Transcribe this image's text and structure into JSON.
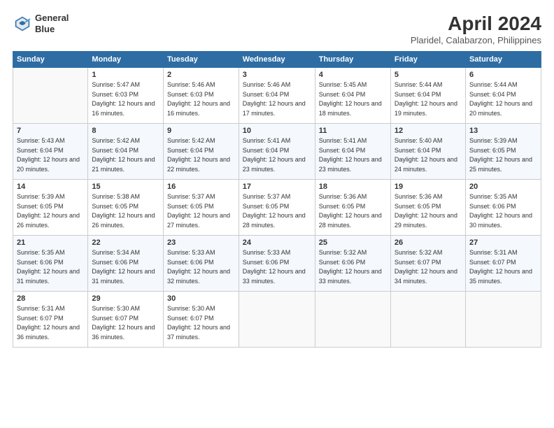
{
  "header": {
    "logo_line1": "General",
    "logo_line2": "Blue",
    "month": "April 2024",
    "location": "Plaridel, Calabarzon, Philippines"
  },
  "weekdays": [
    "Sunday",
    "Monday",
    "Tuesday",
    "Wednesday",
    "Thursday",
    "Friday",
    "Saturday"
  ],
  "weeks": [
    [
      {
        "day": "",
        "sunrise": "",
        "sunset": "",
        "daylight": "",
        "empty": true
      },
      {
        "day": "1",
        "sunrise": "Sunrise: 5:47 AM",
        "sunset": "Sunset: 6:03 PM",
        "daylight": "Daylight: 12 hours and 16 minutes."
      },
      {
        "day": "2",
        "sunrise": "Sunrise: 5:46 AM",
        "sunset": "Sunset: 6:03 PM",
        "daylight": "Daylight: 12 hours and 16 minutes."
      },
      {
        "day": "3",
        "sunrise": "Sunrise: 5:46 AM",
        "sunset": "Sunset: 6:04 PM",
        "daylight": "Daylight: 12 hours and 17 minutes."
      },
      {
        "day": "4",
        "sunrise": "Sunrise: 5:45 AM",
        "sunset": "Sunset: 6:04 PM",
        "daylight": "Daylight: 12 hours and 18 minutes."
      },
      {
        "day": "5",
        "sunrise": "Sunrise: 5:44 AM",
        "sunset": "Sunset: 6:04 PM",
        "daylight": "Daylight: 12 hours and 19 minutes."
      },
      {
        "day": "6",
        "sunrise": "Sunrise: 5:44 AM",
        "sunset": "Sunset: 6:04 PM",
        "daylight": "Daylight: 12 hours and 20 minutes."
      }
    ],
    [
      {
        "day": "7",
        "sunrise": "Sunrise: 5:43 AM",
        "sunset": "Sunset: 6:04 PM",
        "daylight": "Daylight: 12 hours and 20 minutes."
      },
      {
        "day": "8",
        "sunrise": "Sunrise: 5:42 AM",
        "sunset": "Sunset: 6:04 PM",
        "daylight": "Daylight: 12 hours and 21 minutes."
      },
      {
        "day": "9",
        "sunrise": "Sunrise: 5:42 AM",
        "sunset": "Sunset: 6:04 PM",
        "daylight": "Daylight: 12 hours and 22 minutes."
      },
      {
        "day": "10",
        "sunrise": "Sunrise: 5:41 AM",
        "sunset": "Sunset: 6:04 PM",
        "daylight": "Daylight: 12 hours and 23 minutes."
      },
      {
        "day": "11",
        "sunrise": "Sunrise: 5:41 AM",
        "sunset": "Sunset: 6:04 PM",
        "daylight": "Daylight: 12 hours and 23 minutes."
      },
      {
        "day": "12",
        "sunrise": "Sunrise: 5:40 AM",
        "sunset": "Sunset: 6:04 PM",
        "daylight": "Daylight: 12 hours and 24 minutes."
      },
      {
        "day": "13",
        "sunrise": "Sunrise: 5:39 AM",
        "sunset": "Sunset: 6:05 PM",
        "daylight": "Daylight: 12 hours and 25 minutes."
      }
    ],
    [
      {
        "day": "14",
        "sunrise": "Sunrise: 5:39 AM",
        "sunset": "Sunset: 6:05 PM",
        "daylight": "Daylight: 12 hours and 26 minutes."
      },
      {
        "day": "15",
        "sunrise": "Sunrise: 5:38 AM",
        "sunset": "Sunset: 6:05 PM",
        "daylight": "Daylight: 12 hours and 26 minutes."
      },
      {
        "day": "16",
        "sunrise": "Sunrise: 5:37 AM",
        "sunset": "Sunset: 6:05 PM",
        "daylight": "Daylight: 12 hours and 27 minutes."
      },
      {
        "day": "17",
        "sunrise": "Sunrise: 5:37 AM",
        "sunset": "Sunset: 6:05 PM",
        "daylight": "Daylight: 12 hours and 28 minutes."
      },
      {
        "day": "18",
        "sunrise": "Sunrise: 5:36 AM",
        "sunset": "Sunset: 6:05 PM",
        "daylight": "Daylight: 12 hours and 28 minutes."
      },
      {
        "day": "19",
        "sunrise": "Sunrise: 5:36 AM",
        "sunset": "Sunset: 6:05 PM",
        "daylight": "Daylight: 12 hours and 29 minutes."
      },
      {
        "day": "20",
        "sunrise": "Sunrise: 5:35 AM",
        "sunset": "Sunset: 6:06 PM",
        "daylight": "Daylight: 12 hours and 30 minutes."
      }
    ],
    [
      {
        "day": "21",
        "sunrise": "Sunrise: 5:35 AM",
        "sunset": "Sunset: 6:06 PM",
        "daylight": "Daylight: 12 hours and 31 minutes."
      },
      {
        "day": "22",
        "sunrise": "Sunrise: 5:34 AM",
        "sunset": "Sunset: 6:06 PM",
        "daylight": "Daylight: 12 hours and 31 minutes."
      },
      {
        "day": "23",
        "sunrise": "Sunrise: 5:33 AM",
        "sunset": "Sunset: 6:06 PM",
        "daylight": "Daylight: 12 hours and 32 minutes."
      },
      {
        "day": "24",
        "sunrise": "Sunrise: 5:33 AM",
        "sunset": "Sunset: 6:06 PM",
        "daylight": "Daylight: 12 hours and 33 minutes."
      },
      {
        "day": "25",
        "sunrise": "Sunrise: 5:32 AM",
        "sunset": "Sunset: 6:06 PM",
        "daylight": "Daylight: 12 hours and 33 minutes."
      },
      {
        "day": "26",
        "sunrise": "Sunrise: 5:32 AM",
        "sunset": "Sunset: 6:07 PM",
        "daylight": "Daylight: 12 hours and 34 minutes."
      },
      {
        "day": "27",
        "sunrise": "Sunrise: 5:31 AM",
        "sunset": "Sunset: 6:07 PM",
        "daylight": "Daylight: 12 hours and 35 minutes."
      }
    ],
    [
      {
        "day": "28",
        "sunrise": "Sunrise: 5:31 AM",
        "sunset": "Sunset: 6:07 PM",
        "daylight": "Daylight: 12 hours and 36 minutes."
      },
      {
        "day": "29",
        "sunrise": "Sunrise: 5:30 AM",
        "sunset": "Sunset: 6:07 PM",
        "daylight": "Daylight: 12 hours and 36 minutes."
      },
      {
        "day": "30",
        "sunrise": "Sunrise: 5:30 AM",
        "sunset": "Sunset: 6:07 PM",
        "daylight": "Daylight: 12 hours and 37 minutes."
      },
      {
        "day": "",
        "sunrise": "",
        "sunset": "",
        "daylight": "",
        "empty": true
      },
      {
        "day": "",
        "sunrise": "",
        "sunset": "",
        "daylight": "",
        "empty": true
      },
      {
        "day": "",
        "sunrise": "",
        "sunset": "",
        "daylight": "",
        "empty": true
      },
      {
        "day": "",
        "sunrise": "",
        "sunset": "",
        "daylight": "",
        "empty": true
      }
    ]
  ]
}
